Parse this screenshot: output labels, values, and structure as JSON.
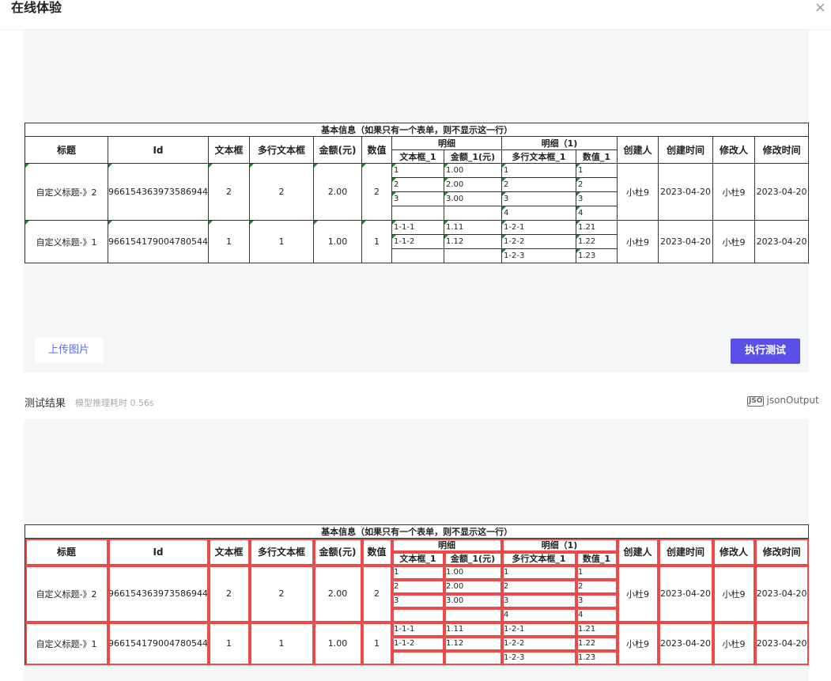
{
  "header": {
    "title": "在线体验",
    "close_icon": "×"
  },
  "table": {
    "caption": "基本信息（如果只有一个表单，则不显示这一行）",
    "headers": {
      "title": "标题",
      "id": "Id",
      "textbox": "文本框",
      "multiline": "多行文本框",
      "amount": "金额(元)",
      "number": "数值",
      "detail": "明细",
      "detail1": "明细（1)",
      "creator": "创建人",
      "created": "创建时间",
      "modifier": "修改人",
      "modified": "修改时间"
    },
    "subheaders": {
      "text1": "文本框_1",
      "amount1": "金额_1(元)",
      "multiline1": "多行文本框_1",
      "number1": "数值_1"
    },
    "rows": [
      {
        "title": "自定义标题-》2",
        "id": "966154363973586944",
        "textbox": "2",
        "multiline": "2",
        "amount": "2.00",
        "number": "2",
        "creator": "小杜9",
        "created": "2023-04-20",
        "modifier": "小杜9",
        "modified": "2023-04-20",
        "sub": [
          {
            "text1": "1",
            "amount1": "1.00",
            "multiline1": "1",
            "number1": "1"
          },
          {
            "text1": "2",
            "amount1": "2.00",
            "multiline1": "2",
            "number1": "2"
          },
          {
            "text1": "3",
            "amount1": "3.00",
            "multiline1": "3",
            "number1": "3"
          },
          {
            "text1": "",
            "amount1": "",
            "multiline1": "4",
            "number1": "4"
          }
        ]
      },
      {
        "title": "自定义标题-》1",
        "id": "966154179004780544",
        "textbox": "1",
        "multiline": "1",
        "amount": "1.00",
        "number": "1",
        "creator": "小杜9",
        "created": "2023-04-20",
        "modifier": "小杜9",
        "modified": "2023-04-20",
        "sub": [
          {
            "text1": "1-1-1",
            "amount1": "1.11",
            "multiline1": "1-2-1",
            "number1": "1.21"
          },
          {
            "text1": "1-1-2",
            "amount1": "1.12",
            "multiline1": "1-2-2",
            "number1": "1.22"
          },
          {
            "text1": "",
            "amount1": "",
            "multiline1": "1-2-3",
            "number1": "1.23"
          }
        ]
      }
    ]
  },
  "actions": {
    "upload": "上传图片",
    "run": "执行测试"
  },
  "result": {
    "label": "测试结果",
    "time": "模型推理耗时 0.56s",
    "json_icon": "JSO",
    "json_label": "jsonOutput"
  },
  "colors": {
    "accent": "#5b50e6",
    "link": "#5b6cf0",
    "highlight": "#f04848"
  }
}
